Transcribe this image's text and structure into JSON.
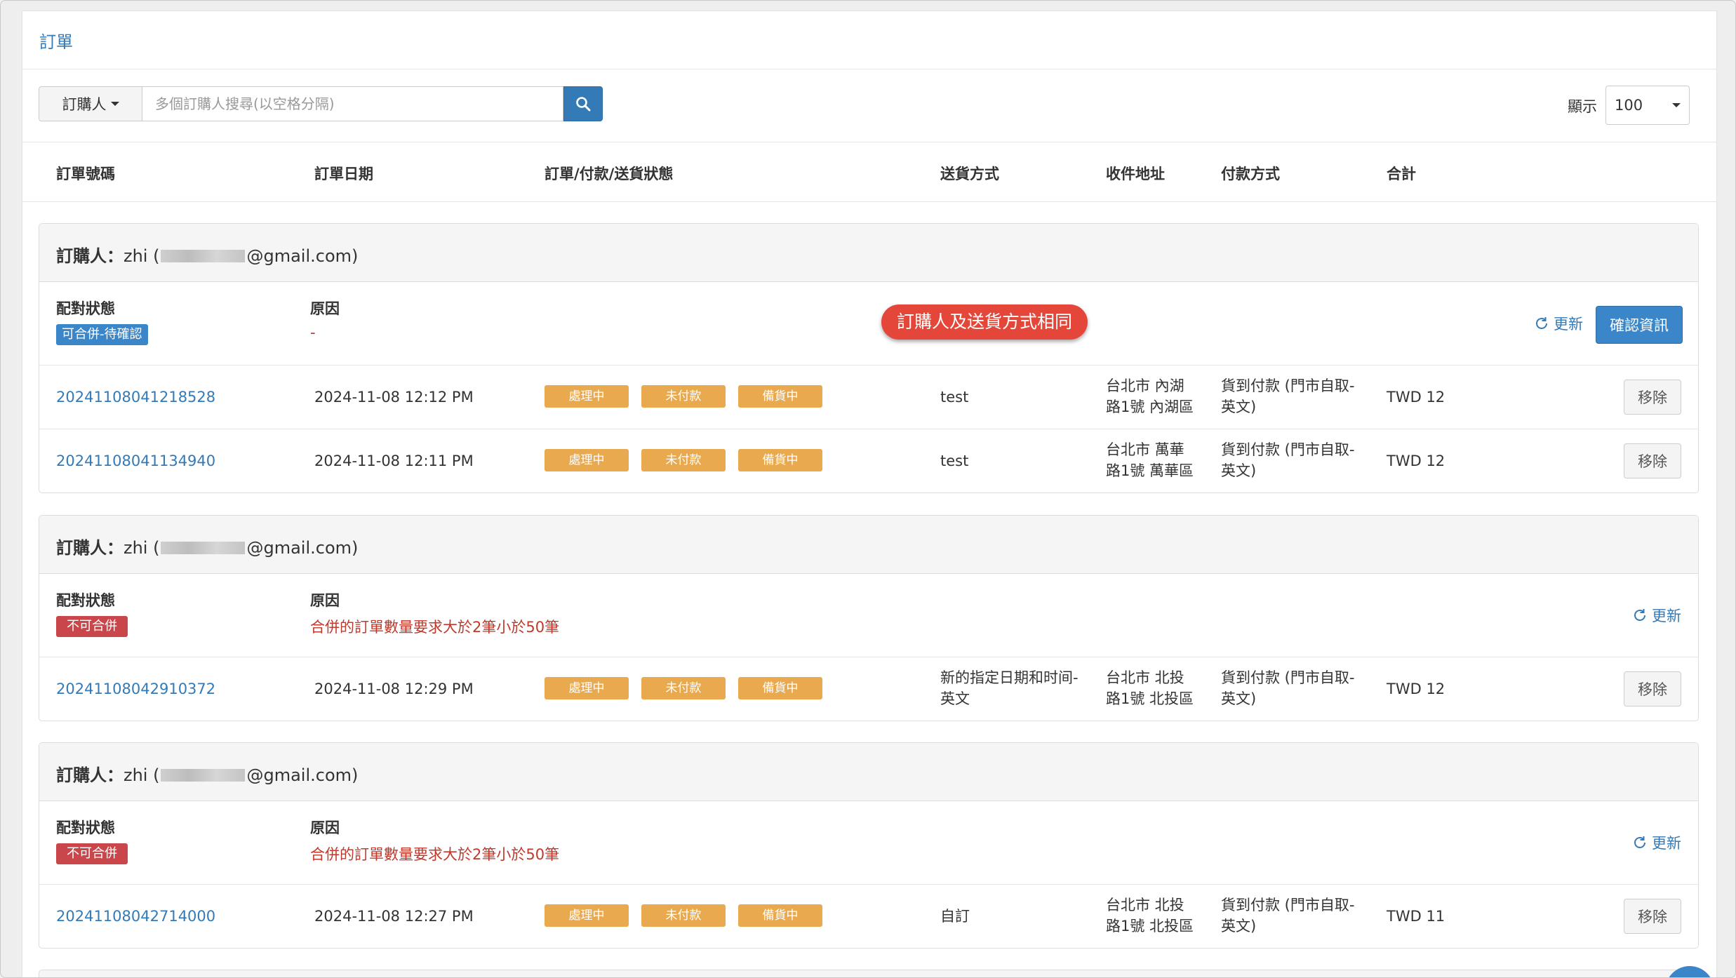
{
  "page": {
    "title": "訂單"
  },
  "search": {
    "filter_label": "訂購人",
    "placeholder": "多個訂購人搜尋(以空格分隔)"
  },
  "display": {
    "label": "顯示",
    "value": "100"
  },
  "columns": [
    "訂單號碼",
    "訂單日期",
    "訂單/付款/送貨狀態",
    "送貨方式",
    "收件地址",
    "付款方式",
    "合計"
  ],
  "labels": {
    "buyer_prefix": "訂購人：",
    "match_status": "配對狀態",
    "reason": "原因",
    "refresh": "更新",
    "confirm": "確認資訊",
    "remove": "移除"
  },
  "callout": "訂購人及送貨方式相同",
  "groups": [
    {
      "buyer_name": "zhi (",
      "buyer_email_suffix": "@gmail.com)",
      "match_badge": "可合併-待確認",
      "reason": "-",
      "orders": [
        {
          "id": "20241108041218528",
          "date": "2024-11-08 12:12 PM",
          "status": [
            "處理中",
            "未付款",
            "備貨中"
          ],
          "shipping": "test",
          "address": [
            "台北市 內湖",
            "路1號 內湖區"
          ],
          "payment": [
            "貨到付款 (門市自取-",
            "英文)"
          ],
          "total": "TWD 12"
        },
        {
          "id": "20241108041134940",
          "date": "2024-11-08 12:11 PM",
          "status": [
            "處理中",
            "未付款",
            "備貨中"
          ],
          "shipping": "test",
          "address": [
            "台北市 萬華",
            "路1號 萬華區"
          ],
          "payment": [
            "貨到付款 (門市自取-",
            "英文)"
          ],
          "total": "TWD 12"
        }
      ]
    },
    {
      "buyer_name": "zhi (",
      "buyer_email_suffix": "@gmail.com)",
      "match_badge": "不可合併",
      "reason": "合併的訂單數量要求大於2筆小於50筆",
      "orders": [
        {
          "id": "20241108042910372",
          "date": "2024-11-08 12:29 PM",
          "status": [
            "處理中",
            "未付款",
            "備貨中"
          ],
          "shipping": [
            "新的指定日期和时间-",
            "英文"
          ],
          "address": [
            "台北市 北投",
            "路1號 北投區"
          ],
          "payment": [
            "貨到付款 (門市自取-",
            "英文)"
          ],
          "total": "TWD 12"
        }
      ]
    },
    {
      "buyer_name": "zhi (",
      "buyer_email_suffix": "@gmail.com)",
      "match_badge": "不可合併",
      "reason": "合併的訂單數量要求大於2筆小於50筆",
      "orders": [
        {
          "id": "20241108042714000",
          "date": "2024-11-08 12:27 PM",
          "status": [
            "處理中",
            "未付款",
            "備貨中"
          ],
          "shipping": "自訂",
          "address": [
            "台北市 北投",
            "路1號 北投區"
          ],
          "payment": [
            "貨到付款 (門市自取-",
            "英文)"
          ],
          "total": "TWD 11"
        }
      ]
    }
  ],
  "colors": {
    "link": "#337ab7",
    "tag": "#e8a94f",
    "badge_ok": "#3a86c8",
    "badge_no": "#c9474a",
    "callout": "#e4463a"
  }
}
